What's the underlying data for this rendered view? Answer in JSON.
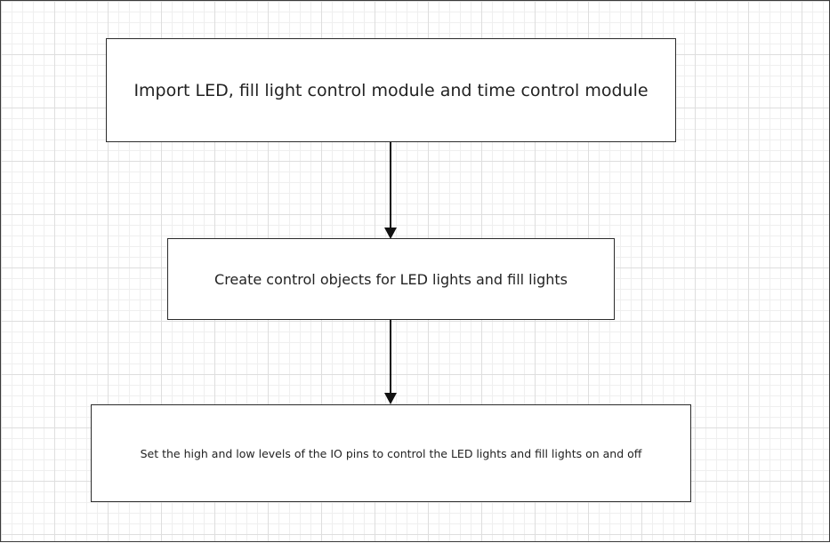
{
  "flowchart": {
    "steps": [
      {
        "label": "Import LED, fill light control module and time control module"
      },
      {
        "label": "Create control objects for LED lights and fill lights"
      },
      {
        "label": "Set the high and low levels of the IO pins to control the LED lights and fill lights on and off"
      }
    ],
    "colors": {
      "stroke": "#2b2b2b",
      "text": "#222222",
      "grid": "#dedede",
      "background": "#ffffff"
    }
  }
}
